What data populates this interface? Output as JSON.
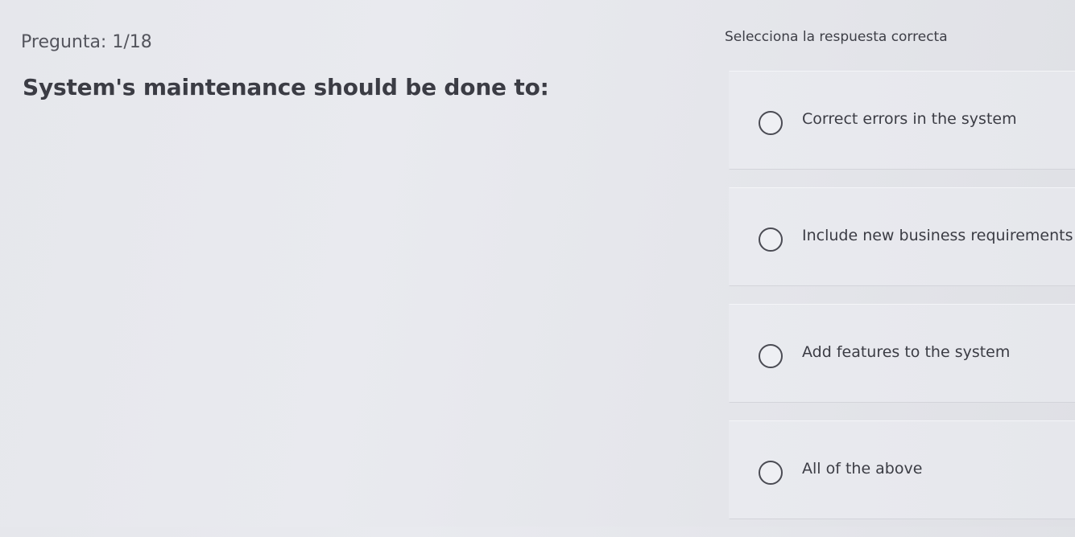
{
  "question": {
    "counter": "Pregunta: 1/18",
    "text": "System's maintenance should be done to:"
  },
  "instruction": "Selecciona la respuesta correcta",
  "options": [
    {
      "label": "Correct errors in the system",
      "selected": false
    },
    {
      "label": "Include new business requirements",
      "selected": false
    },
    {
      "label": "Add features to the system",
      "selected": false
    },
    {
      "label": "All of the above",
      "selected": false
    }
  ]
}
